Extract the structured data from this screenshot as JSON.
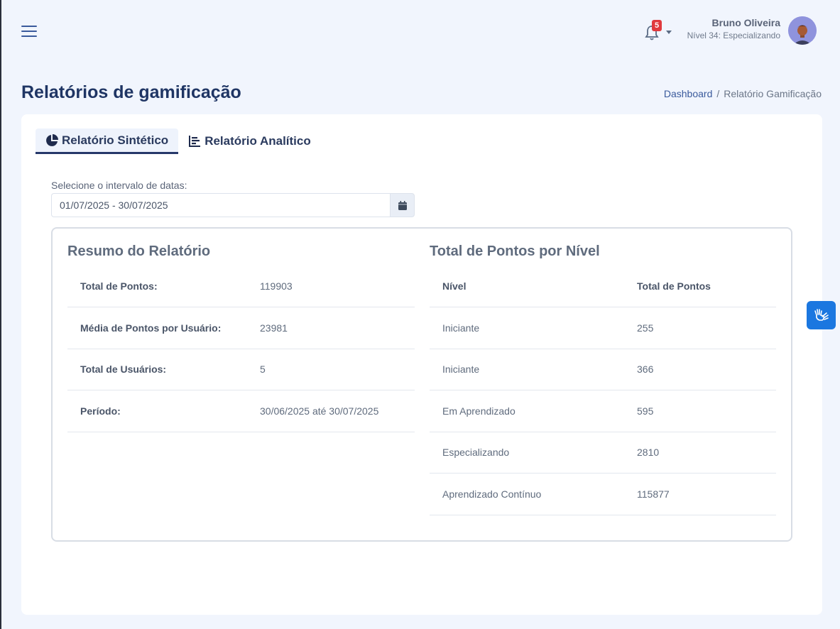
{
  "header": {
    "notification_count": "5",
    "user_name": "Bruno Oliveira",
    "user_level": "Nível 34: Especializando"
  },
  "page": {
    "title": "Relatórios de gamificação",
    "breadcrumb": {
      "home": "Dashboard",
      "separator": "/",
      "current": "Relatório Gamificação"
    }
  },
  "tabs": [
    {
      "label": "Relatório Sintético",
      "icon": "pie-chart-icon",
      "active": true
    },
    {
      "label": "Relatório Analítico",
      "icon": "bar-chart-icon",
      "active": false
    }
  ],
  "filter": {
    "label": "Selecione o intervalo de datas:",
    "value": "01/07/2025 - 30/07/2025",
    "button_icon": "calendar-icon"
  },
  "summary": {
    "title": "Resumo do Relatório",
    "rows": [
      {
        "key": "Total de Pontos:",
        "value": "119903"
      },
      {
        "key": "Média de Pontos por Usuário:",
        "value": "23981"
      },
      {
        "key": "Total de Usuários:",
        "value": "5"
      },
      {
        "key": "Período:",
        "value": "30/06/2025 até 30/07/2025"
      }
    ]
  },
  "levels": {
    "title": "Total de Pontos por Nível",
    "columns": [
      "Nível",
      "Total de Pontos"
    ],
    "rows": [
      {
        "level": "Iniciante",
        "points": "255"
      },
      {
        "level": "Iniciante",
        "points": "366"
      },
      {
        "level": "Em Aprendizado",
        "points": "595"
      },
      {
        "level": "Especializando",
        "points": "2810"
      },
      {
        "level": "Aprendizado Contínuo",
        "points": "115877"
      }
    ]
  },
  "colors": {
    "accent": "#1f3564",
    "badge": "#e03a3e",
    "a11y_button": "#1b77e0"
  }
}
